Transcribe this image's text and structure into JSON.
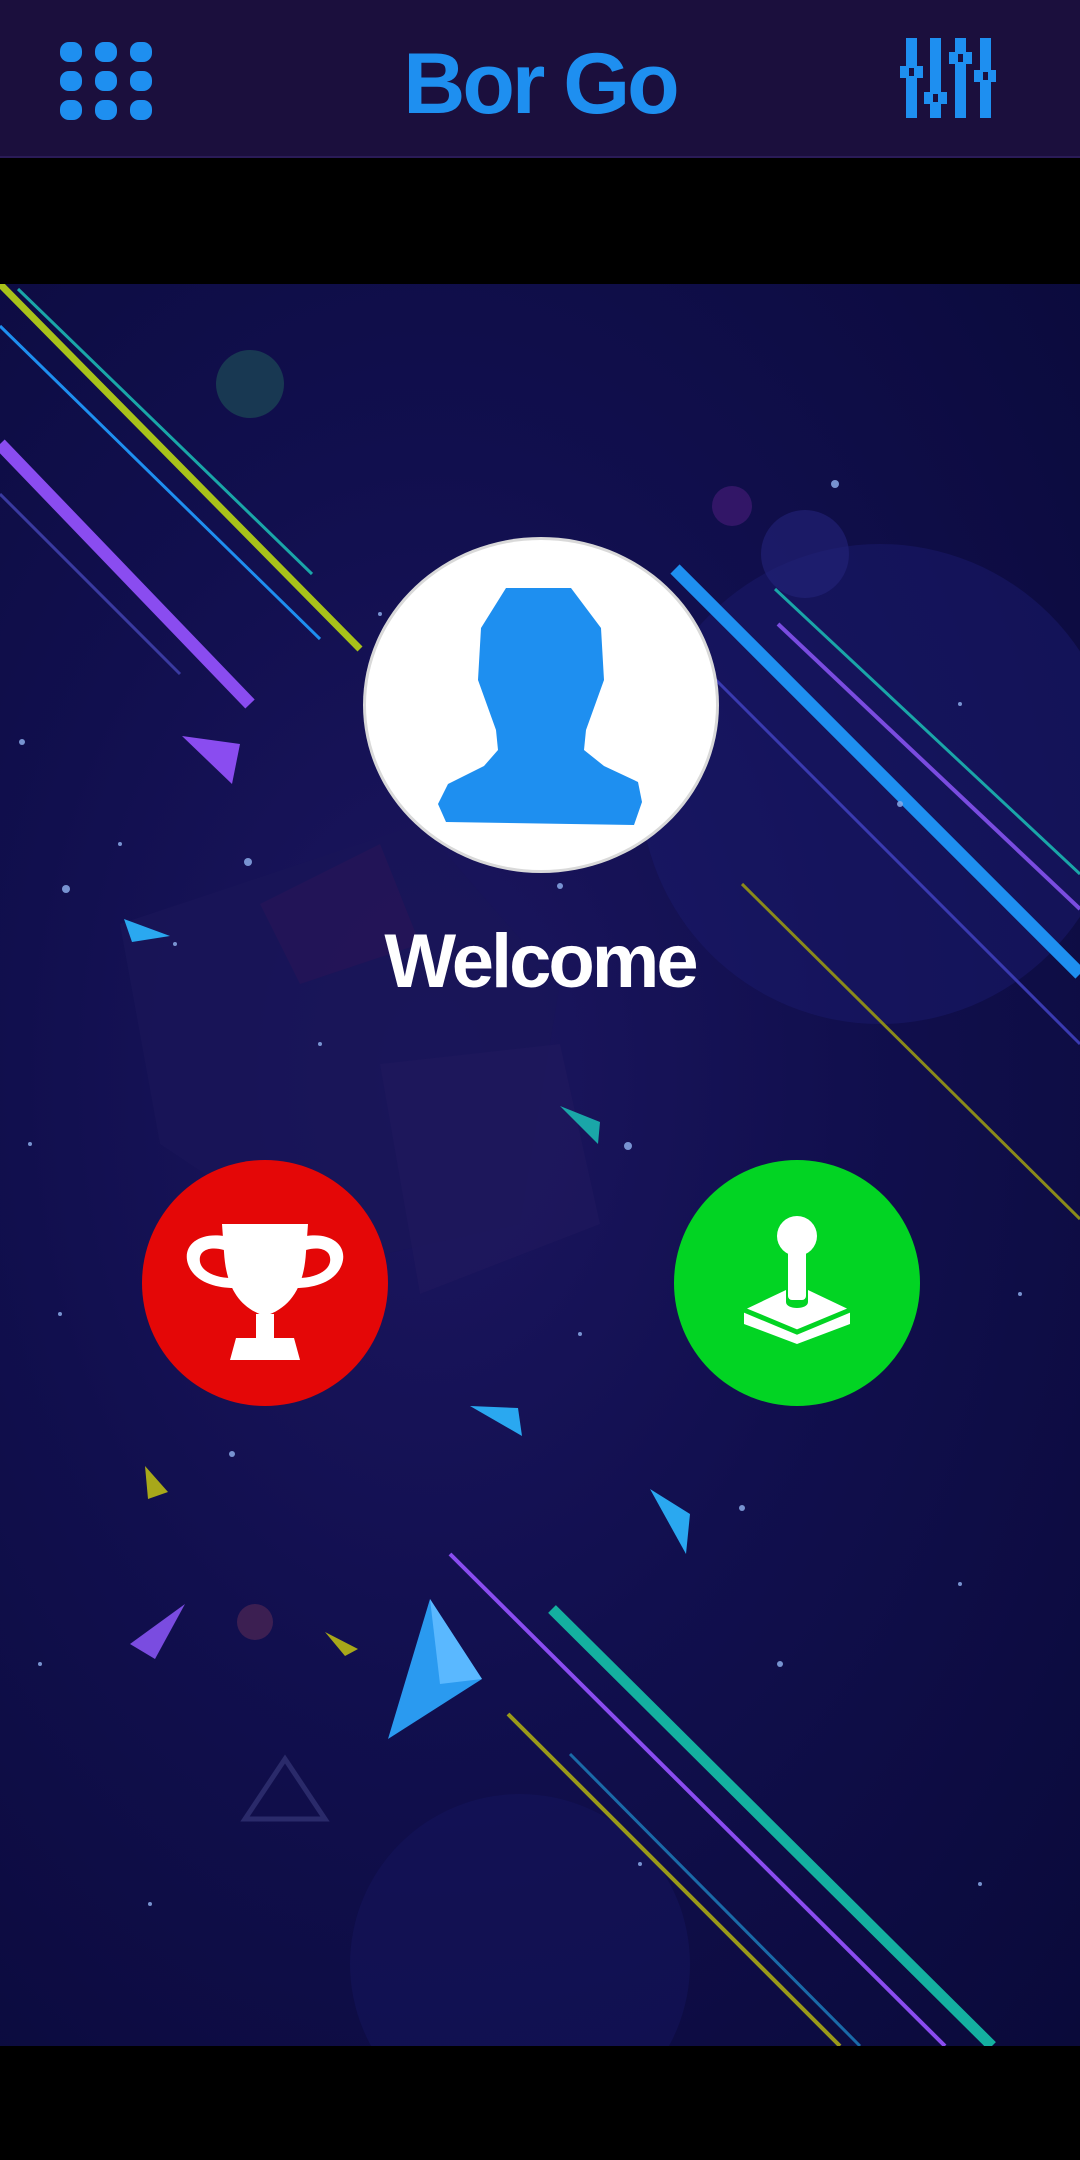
{
  "header": {
    "title": "Bor Go",
    "menu_icon": "grid-menu-icon",
    "settings_icon": "sliders-icon"
  },
  "main": {
    "welcome_text": "Welcome",
    "avatar_icon": "user-silhouette-icon",
    "trophy_icon": "trophy-icon",
    "play_icon": "joystick-icon"
  },
  "colors": {
    "header_bg": "#1b0f3d",
    "accent_blue": "#1e8ff0",
    "trophy_red": "#e40707",
    "play_green": "#02d423",
    "scene_bg": "#110f4e"
  }
}
